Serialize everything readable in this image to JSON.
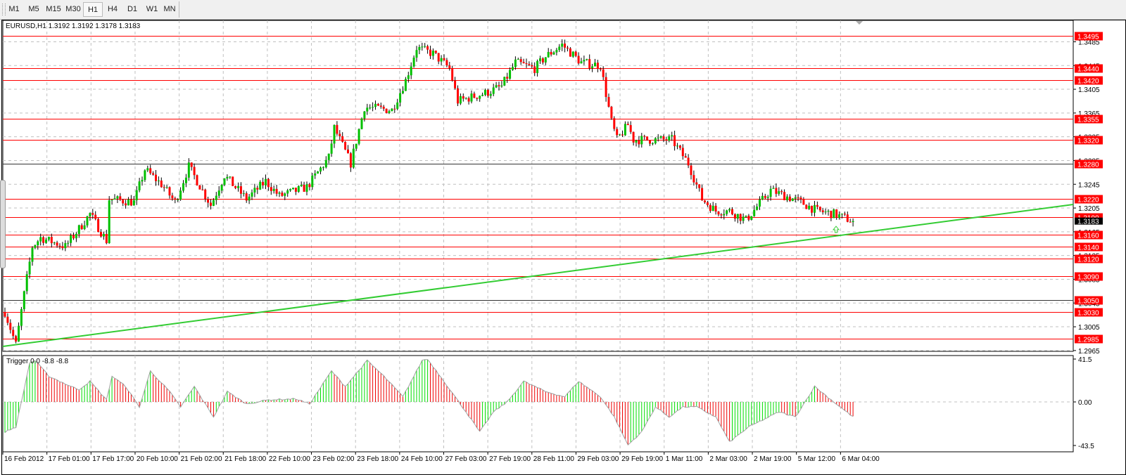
{
  "toolbar": {
    "timeframes": [
      "M1",
      "M5",
      "M15",
      "M30",
      "H1",
      "H4",
      "D1",
      "W1",
      "MN"
    ],
    "active": "H1"
  },
  "chart": {
    "symbol_info": "EURUSD,H1  1.3192 1.3192 1.3178 1.3183",
    "current_price": "1.3183",
    "price_ticks": [
      "1.3485",
      "1.3445",
      "1.3405",
      "1.3365",
      "1.3325",
      "1.3285",
      "1.3245",
      "1.3205",
      "1.3165",
      "1.3125",
      "1.3085",
      "1.3045",
      "1.3005",
      "1.2965"
    ],
    "levels": [
      {
        "price": "1.3495",
        "color": "#ff0000"
      },
      {
        "price": "1.3440",
        "color": "#ff0000"
      },
      {
        "price": "1.3420",
        "color": "#ff0000"
      },
      {
        "price": "1.3355",
        "color": "#ff0000"
      },
      {
        "price": "1.3320",
        "color": "#ff0000"
      },
      {
        "price": "1.3280",
        "color": "#333333"
      },
      {
        "price": "1.3220",
        "color": "#ff0000"
      },
      {
        "price": "1.3190",
        "color": "#ff0000"
      },
      {
        "price": "1.3160",
        "color": "#ff0000"
      },
      {
        "price": "1.3140",
        "color": "#ff0000"
      },
      {
        "price": "1.3120",
        "color": "#ff0000"
      },
      {
        "price": "1.3090",
        "color": "#ff0000"
      },
      {
        "price": "1.3050",
        "color": "#333333"
      },
      {
        "price": "1.3030",
        "color": "#ff0000"
      },
      {
        "price": "1.2985",
        "color": "#ff0000"
      }
    ],
    "time_labels": [
      "16 Feb 2012",
      "17 Feb 01:00",
      "17 Feb 17:00",
      "20 Feb 10:00",
      "21 Feb 02:00",
      "21 Feb 18:00",
      "22 Feb 10:00",
      "23 Feb 02:00",
      "23 Feb 18:00",
      "24 Feb 10:00",
      "27 Feb 03:00",
      "27 Feb 19:00",
      "28 Feb 11:00",
      "29 Feb 03:00",
      "29 Feb 19:00",
      "1 Mar 11:00",
      "2 Mar 03:00",
      "2 Mar 19:00",
      "5 Mar 12:00",
      "6 Mar 04:00"
    ],
    "colors": {
      "bull": "#00c000",
      "bear": "#ff0000",
      "level": "#ff0000",
      "trendline": "#33cc33"
    }
  },
  "indicator": {
    "label": "Trigger 0.0 -8.8 -8.8",
    "ticks": [
      "41.5",
      "0.00",
      "-43.5"
    ]
  },
  "chart_data": {
    "type": "line",
    "title": "EURUSD,H1",
    "ylim": [
      1.2965,
      1.3495
    ],
    "price_path_bar_index": [
      0,
      4,
      7,
      10,
      13,
      22,
      27,
      31,
      37,
      38,
      47,
      51,
      57,
      62,
      67,
      75,
      80,
      88,
      95,
      100,
      110,
      118,
      120,
      126,
      131,
      141,
      146,
      150,
      156,
      162,
      165,
      176,
      181,
      186,
      193,
      197,
      203,
      210,
      217,
      221,
      223,
      227,
      229,
      235,
      243,
      249,
      254,
      259,
      264,
      270,
      279,
      290,
      296,
      302,
      309
    ],
    "price_path_close": [
      1.303,
      1.2975,
      1.306,
      1.314,
      1.3155,
      1.314,
      1.317,
      1.3195,
      1.315,
      1.322,
      1.3215,
      1.327,
      1.3245,
      1.3215,
      1.3275,
      1.321,
      1.326,
      1.322,
      1.325,
      1.3225,
      1.324,
      1.329,
      1.334,
      1.328,
      1.3375,
      1.337,
      1.342,
      1.3475,
      1.3465,
      1.344,
      1.3385,
      1.34,
      1.341,
      1.345,
      1.344,
      1.346,
      1.348,
      1.345,
      1.3445,
      1.335,
      1.332,
      1.3345,
      1.332,
      1.332,
      1.332,
      1.328,
      1.322,
      1.32,
      1.32,
      1.3185,
      1.3235,
      1.3215,
      1.32,
      1.3195,
      1.3183
    ],
    "indicator_ylim": [
      -43.5,
      41.5
    ],
    "indicator_bar_index": [
      0,
      4,
      6,
      9,
      11,
      16,
      24,
      27,
      31,
      37,
      39,
      44,
      49,
      53,
      60,
      64,
      69,
      76,
      81,
      88,
      96,
      106,
      111,
      119,
      124,
      132,
      138,
      145,
      153,
      160,
      168,
      173,
      178,
      183,
      189,
      197,
      204,
      209,
      217,
      222,
      227,
      232,
      237,
      242,
      247,
      252,
      259,
      264,
      271,
      282,
      288,
      295,
      309
    ],
    "indicator_values": [
      -30,
      -25,
      0,
      38,
      40,
      25,
      15,
      12,
      20,
      2,
      25,
      15,
      -5,
      30,
      10,
      -5,
      15,
      -15,
      10,
      -2,
      2,
      3,
      -2,
      30,
      15,
      40,
      25,
      5,
      45,
      20,
      -10,
      -30,
      -10,
      0,
      20,
      10,
      5,
      20,
      5,
      -15,
      -43,
      -30,
      -5,
      -15,
      -5,
      -5,
      -15,
      -40,
      -25,
      -10,
      -15,
      15,
      -15
    ],
    "trendline": {
      "from": {
        "time": "16 Feb 2012",
        "price": 1.2956
      },
      "to": {
        "price": 1.3194
      }
    }
  }
}
